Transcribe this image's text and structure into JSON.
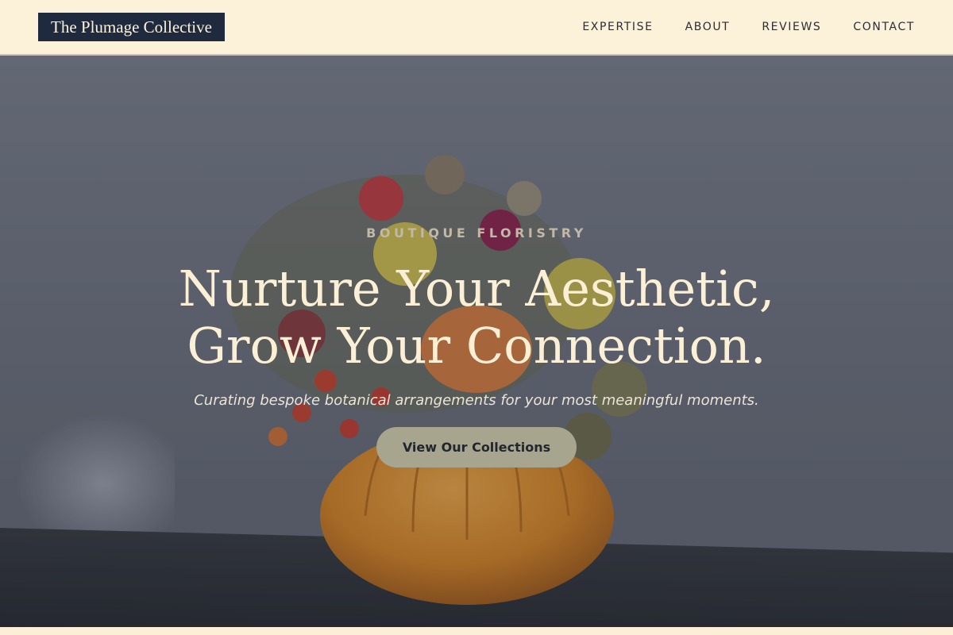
{
  "header": {
    "logo_text": "The Plumage Collective",
    "nav": [
      {
        "label": "EXPERTISE"
      },
      {
        "label": "ABOUT"
      },
      {
        "label": "REVIEWS"
      },
      {
        "label": "CONTACT"
      }
    ]
  },
  "hero": {
    "eyebrow": "BOUTIQUE FLORISTRY",
    "headline_line1": "Nurture Your Aesthetic,",
    "headline_line2": "Grow Your Connection.",
    "subheadline": "Curating bespoke botanical arrangements for your most meaningful moments.",
    "cta_label": "View Our Collections"
  },
  "colors": {
    "header_bg": "#fcf2da",
    "logo_bg": "#1f2a3e",
    "headline": "#fbefd5",
    "cta_bg": "#a7a58e"
  }
}
